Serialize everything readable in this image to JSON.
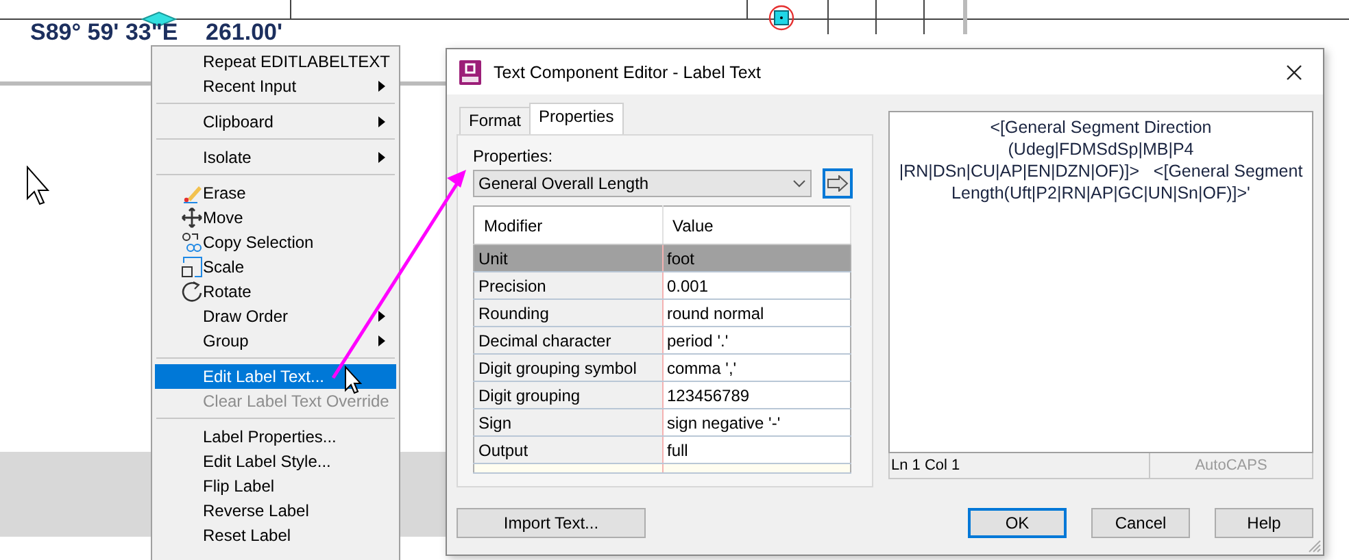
{
  "drawing": {
    "bearing_label": "S89° 59' 33\"E",
    "distance_label": "261.00'"
  },
  "context_menu": {
    "items": [
      {
        "kind": "command",
        "label": "Repeat EDITLABELTEXT",
        "submenu": false,
        "selected": false,
        "disabled": false
      },
      {
        "kind": "command",
        "label": "Recent Input",
        "submenu": true,
        "selected": false,
        "disabled": false
      },
      {
        "kind": "separator"
      },
      {
        "kind": "command",
        "label": "Clipboard",
        "submenu": true,
        "selected": false,
        "disabled": false
      },
      {
        "kind": "separator"
      },
      {
        "kind": "command",
        "label": "Isolate",
        "submenu": true,
        "selected": false,
        "disabled": false
      },
      {
        "kind": "separator"
      },
      {
        "kind": "command",
        "label": "Erase",
        "submenu": false,
        "selected": false,
        "disabled": false
      },
      {
        "kind": "command",
        "label": "Move",
        "submenu": false,
        "selected": false,
        "disabled": false
      },
      {
        "kind": "command",
        "label": "Copy Selection",
        "submenu": false,
        "selected": false,
        "disabled": false
      },
      {
        "kind": "command",
        "label": "Scale",
        "submenu": false,
        "selected": false,
        "disabled": false
      },
      {
        "kind": "command",
        "label": "Rotate",
        "submenu": false,
        "selected": false,
        "disabled": false
      },
      {
        "kind": "command",
        "label": "Draw Order",
        "submenu": true,
        "selected": false,
        "disabled": false
      },
      {
        "kind": "command",
        "label": "Group",
        "submenu": true,
        "selected": false,
        "disabled": false
      },
      {
        "kind": "separator"
      },
      {
        "kind": "command",
        "label": "Edit Label Text...",
        "submenu": false,
        "selected": true,
        "disabled": false
      },
      {
        "kind": "command",
        "label": "Clear Label Text Override",
        "submenu": false,
        "selected": false,
        "disabled": true
      },
      {
        "kind": "separator"
      },
      {
        "kind": "command",
        "label": "Label Properties...",
        "submenu": false,
        "selected": false,
        "disabled": false
      },
      {
        "kind": "command",
        "label": "Edit Label Style...",
        "submenu": false,
        "selected": false,
        "disabled": false
      },
      {
        "kind": "command",
        "label": "Flip Label",
        "submenu": false,
        "selected": false,
        "disabled": false
      },
      {
        "kind": "command",
        "label": "Reverse Label",
        "submenu": false,
        "selected": false,
        "disabled": false
      },
      {
        "kind": "command",
        "label": "Reset Label",
        "submenu": false,
        "selected": false,
        "disabled": false
      }
    ]
  },
  "dialog": {
    "title": "Text Component Editor - Label Text",
    "tabs": [
      {
        "label": "Format",
        "selected": false
      },
      {
        "label": "Properties",
        "selected": true
      }
    ],
    "properties_label": "Properties:",
    "properties_dropdown": {
      "value": "General Overall Length"
    },
    "table": {
      "columns": [
        "Modifier",
        "Value"
      ],
      "rows": [
        {
          "modifier": "Unit",
          "value": "foot",
          "selected": true
        },
        {
          "modifier": "Precision",
          "value": "0.001",
          "selected": false
        },
        {
          "modifier": "Rounding",
          "value": "round normal",
          "selected": false
        },
        {
          "modifier": "Decimal character",
          "value": "period '.'",
          "selected": false
        },
        {
          "modifier": "Digit grouping symbol",
          "value": "comma ','",
          "selected": false
        },
        {
          "modifier": "Digit grouping",
          "value": "123456789",
          "selected": false
        },
        {
          "modifier": "Sign",
          "value": "sign negative '-'",
          "selected": false
        },
        {
          "modifier": "Output",
          "value": "full",
          "selected": false
        }
      ]
    },
    "editor_text": "<[General Segment Direction (Udeg|FDMSdSp|MB|P4 |RN|DSn|CU|AP|EN|DZN|OF)]>   <[General Segment Length(Uft|P2|RN|AP|GC|UN|Sn|OF)]>'",
    "status": {
      "position": "Ln 1 Col 1",
      "mode": "AutoCAPS"
    },
    "buttons": [
      {
        "label": "Import Text...",
        "default": false
      },
      {
        "label": "OK",
        "default": true
      },
      {
        "label": "Cancel",
        "default": false
      },
      {
        "label": "Help",
        "default": false
      }
    ]
  }
}
